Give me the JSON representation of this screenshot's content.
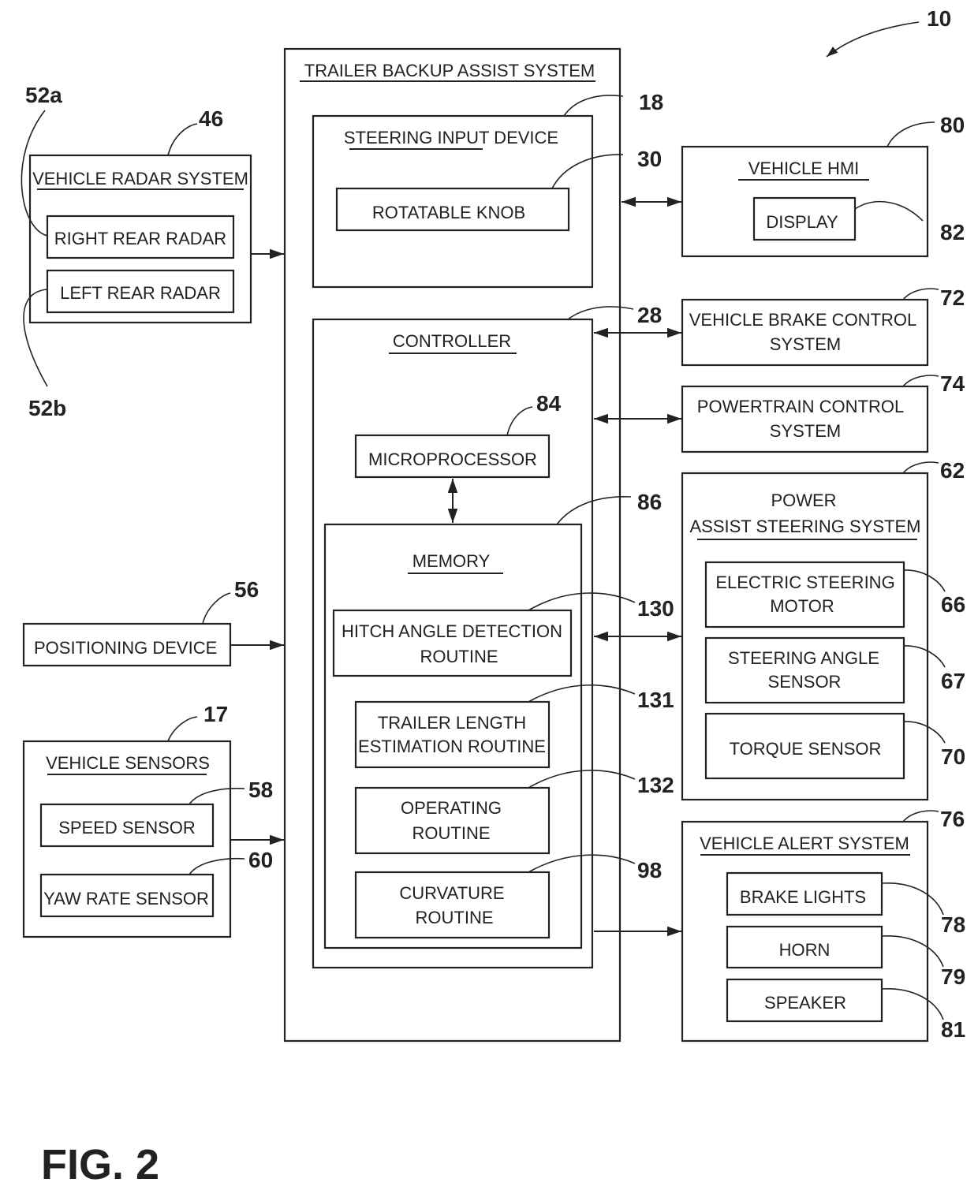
{
  "figure": {
    "caption": "FIG. 2",
    "system_ref": "10"
  },
  "radar": {
    "ref": "46",
    "title": "VEHICLE RADAR SYSTEM",
    "right": {
      "label": "RIGHT REAR RADAR",
      "ref": "52a"
    },
    "left": {
      "label": "LEFT REAR RADAR",
      "ref": "52b"
    }
  },
  "positioning": {
    "label": "POSITIONING DEVICE",
    "ref": "56"
  },
  "sensors": {
    "ref": "17",
    "title": "VEHICLE SENSORS",
    "speed": {
      "label": "SPEED SENSOR",
      "ref": "58"
    },
    "yaw": {
      "label": "YAW RATE SENSOR",
      "ref": "60"
    }
  },
  "tba": {
    "title": "TRAILER BACKUP ASSIST SYSTEM",
    "steering_input": {
      "title": "STEERING INPUT DEVICE",
      "ref": "18",
      "knob": {
        "label": "ROTATABLE KNOB",
        "ref": "30"
      }
    },
    "controller": {
      "title": "CONTROLLER",
      "ref": "28",
      "micro": {
        "label": "MICROPROCESSOR",
        "ref": "84"
      },
      "memory": {
        "title": "MEMORY",
        "ref": "86",
        "hitch": {
          "line1": "HITCH ANGLE DETECTION",
          "line2": "ROUTINE",
          "ref": "130"
        },
        "trailer": {
          "line1": "TRAILER LENGTH",
          "line2": "ESTIMATION ROUTINE",
          "ref": "131"
        },
        "operating": {
          "line1": "OPERATING",
          "line2": "ROUTINE",
          "ref": "132"
        },
        "curvature": {
          "line1": "CURVATURE",
          "line2": "ROUTINE",
          "ref": "98"
        }
      }
    }
  },
  "hmi": {
    "title": "VEHICLE HMI",
    "ref": "80",
    "display": {
      "label": "DISPLAY",
      "ref": "82"
    }
  },
  "brake": {
    "line1": "VEHICLE BRAKE CONTROL",
    "line2": "SYSTEM",
    "ref": "72"
  },
  "powertrain": {
    "line1": "POWERTRAIN CONTROL",
    "line2": "SYSTEM",
    "ref": "74"
  },
  "steering": {
    "line1": "POWER",
    "line2": "ASSIST STEERING SYSTEM",
    "ref": "62",
    "motor": {
      "line1": "ELECTRIC STEERING",
      "line2": "MOTOR",
      "ref": "66"
    },
    "angle": {
      "line1": "STEERING ANGLE",
      "line2": "SENSOR",
      "ref": "67"
    },
    "torque": {
      "label": "TORQUE SENSOR",
      "ref": "70"
    }
  },
  "alert": {
    "title": "VEHICLE ALERT SYSTEM",
    "ref": "76",
    "lights": {
      "label": "BRAKE LIGHTS",
      "ref": "78"
    },
    "horn": {
      "label": "HORN",
      "ref": "79"
    },
    "speaker": {
      "label": "SPEAKER",
      "ref": "81"
    }
  }
}
